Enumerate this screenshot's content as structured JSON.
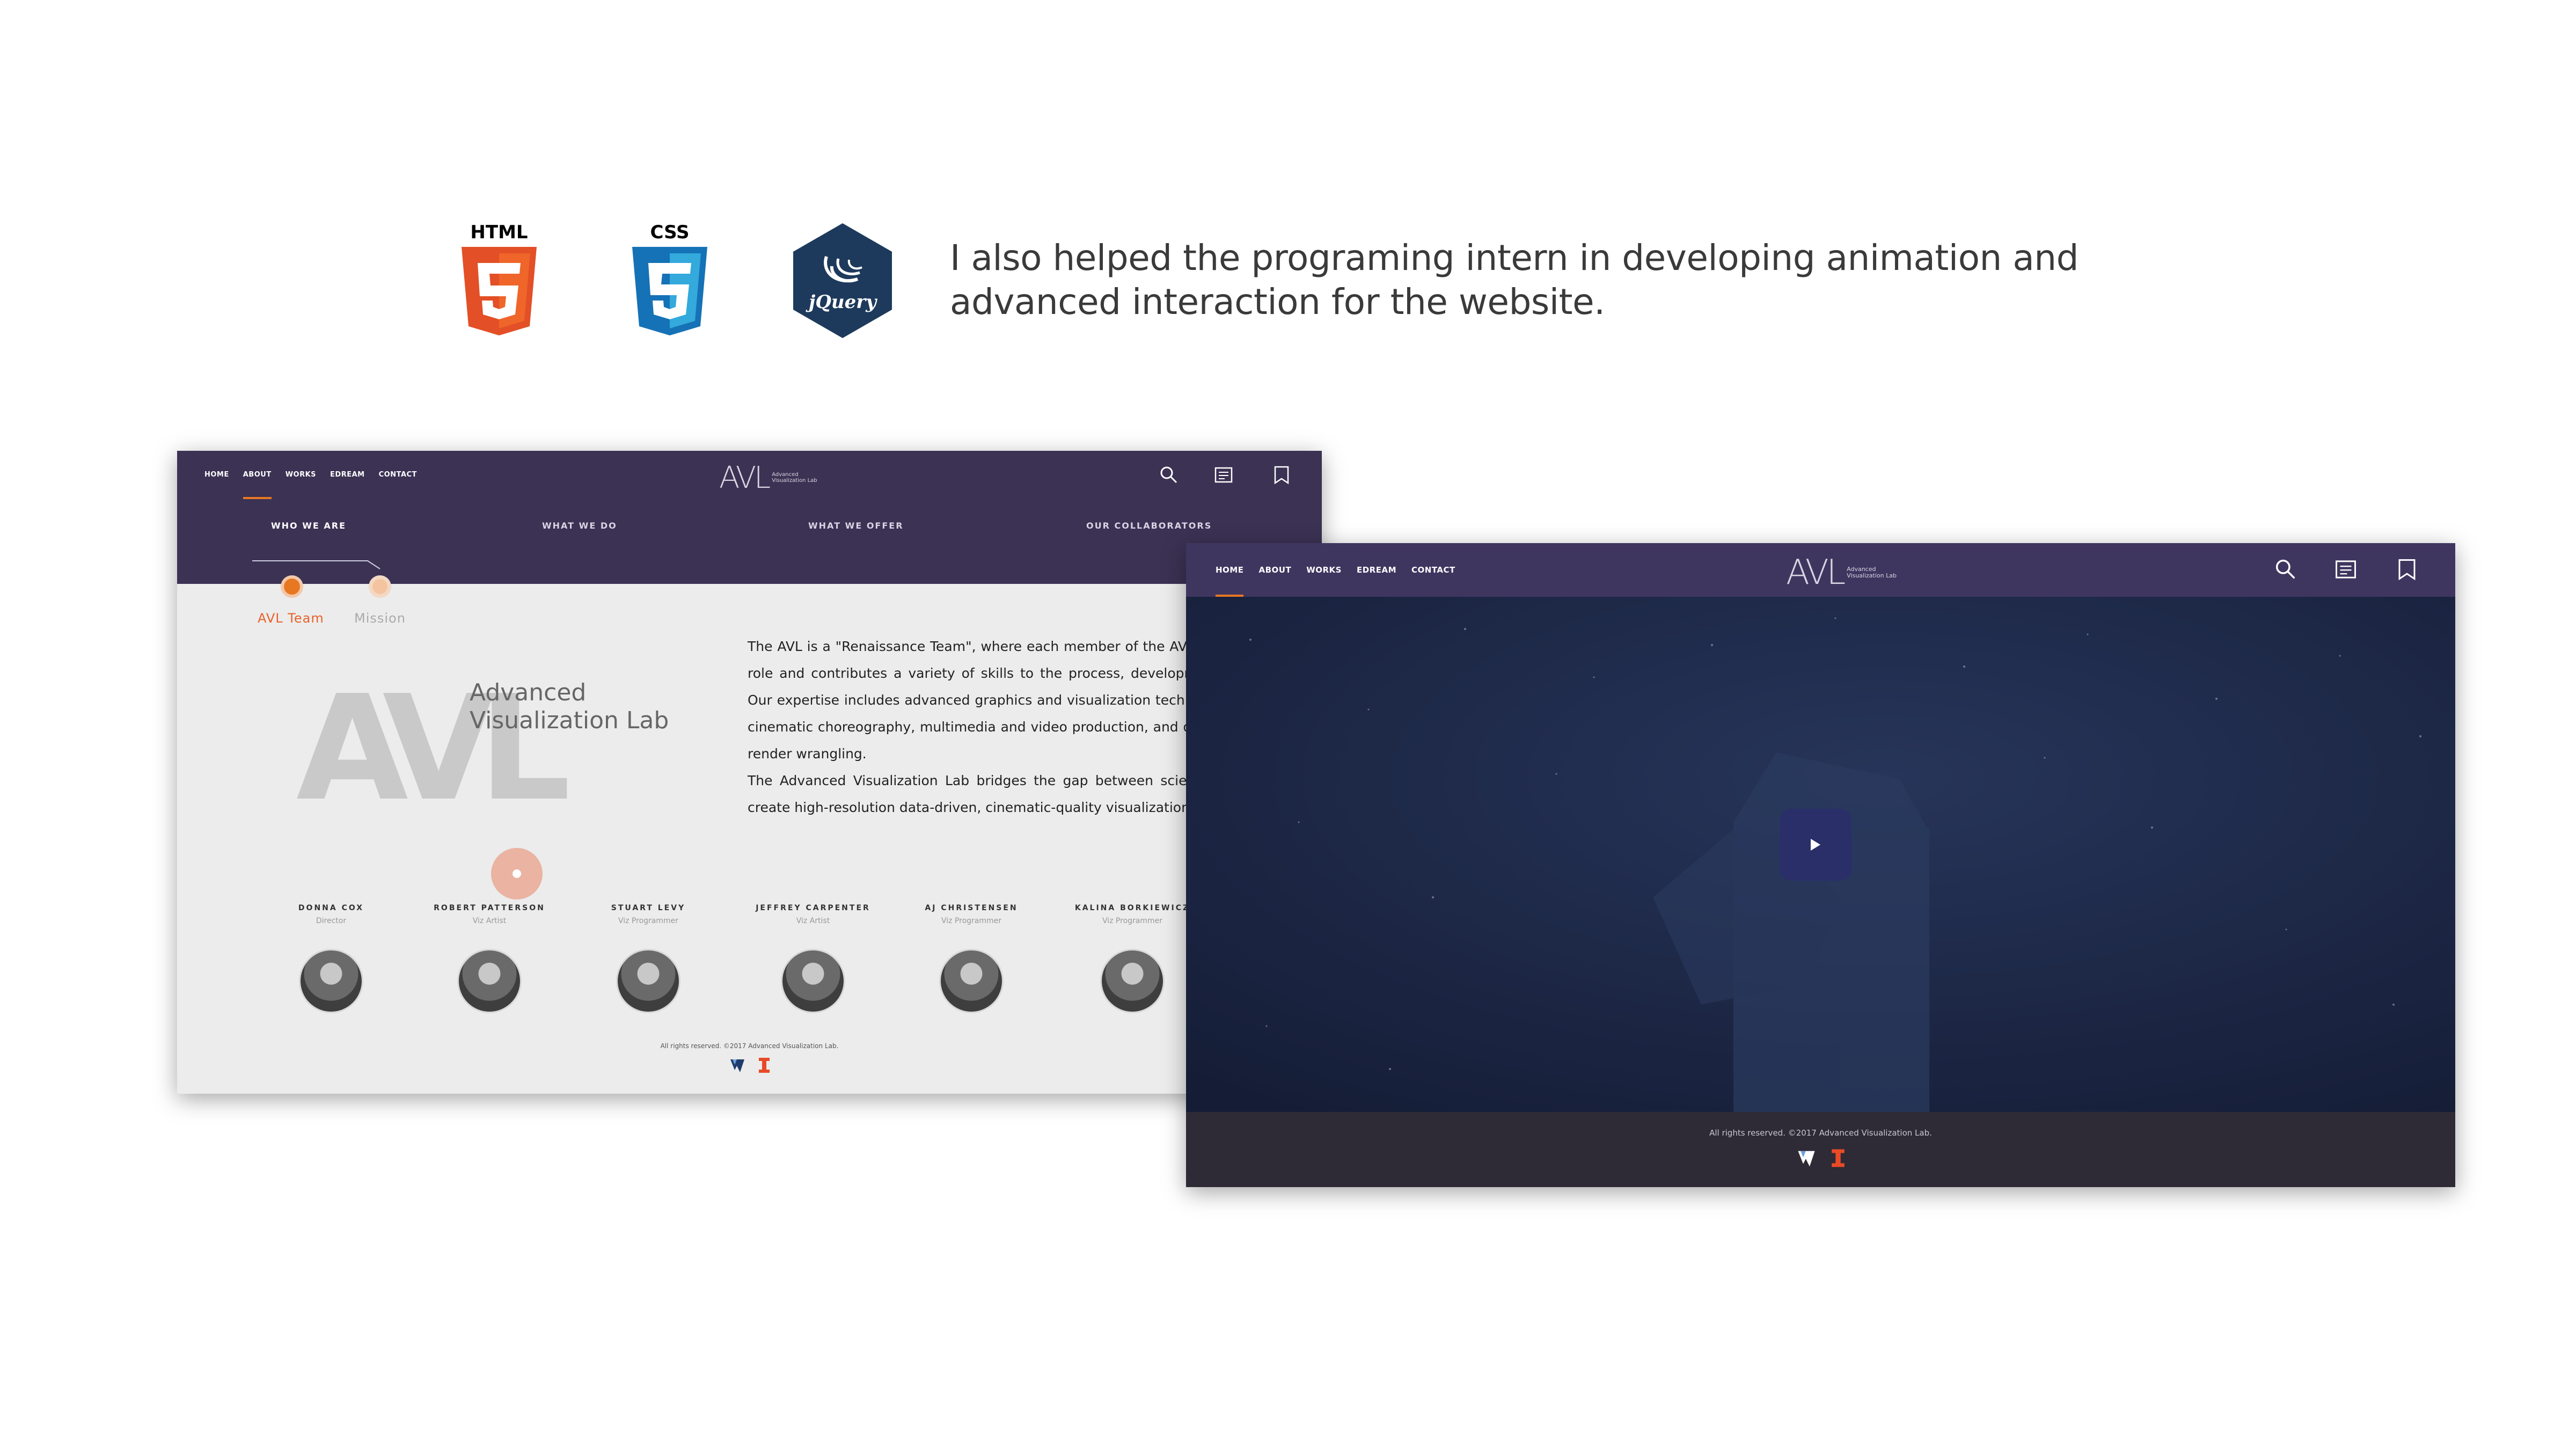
{
  "tech_logos": [
    {
      "label": "HTML",
      "icon": "html5-logo-icon",
      "color": "#e34f26"
    },
    {
      "label": "CSS",
      "icon": "css3-logo-icon",
      "color": "#1572b6"
    },
    {
      "label": "jQuery",
      "icon": "jquery-logo-icon",
      "color": "#1d3a5c"
    }
  ],
  "caption": "I also helped the programing intern in developing animation and advanced interaction for the website.",
  "site_about": {
    "nav": [
      "HOME",
      "ABOUT",
      "WORKS",
      "EDREAM",
      "CONTACT"
    ],
    "active_nav": "ABOUT",
    "brand": {
      "mark": "AVL",
      "sub_line1": "Advanced",
      "sub_line2": "Visualization Lab"
    },
    "subnav": [
      "WHO WE ARE",
      "WHAT WE DO",
      "WHAT WE OFFER",
      "OUR COLLABORATORS"
    ],
    "timeline": {
      "active": "AVL Team",
      "inactive": "Mission"
    },
    "logo_big": {
      "mark": "AVL",
      "line1": "Advanced",
      "line2": "Visualization Lab"
    },
    "about_p1": "The AVL is a \"Renaissance Team\", where each member of the AVL team plays a unique role and contributes a variety of skills to the process, development, and production.  Our expertise includes advanced graphics and visualization techniques, artistic design, cinematic choreography, multimedia and video production, and data management and render wrangling.",
    "about_p2": "The Advanced Visualization Lab bridges the gap between science and the arts. We create high-resolution data-driven, cinematic-quality visualizations for public outreach.",
    "members": [
      {
        "name": "DONNA COX",
        "role": "Director"
      },
      {
        "name": "ROBERT PATTERSON",
        "role": "Viz Artist"
      },
      {
        "name": "STUART LEVY",
        "role": "Viz Programmer"
      },
      {
        "name": "JEFFREY CARPENTER",
        "role": "Viz Artist"
      },
      {
        "name": "AJ CHRISTENSEN",
        "role": "Viz Programmer"
      },
      {
        "name": "KALINA BORKIEWICZ",
        "role": "Viz Programmer"
      }
    ],
    "footer": "All rights reserved. ©2017 Advanced Visualization Lab."
  },
  "site_home": {
    "nav": [
      "HOME",
      "ABOUT",
      "WORKS",
      "EDREAM",
      "CONTACT"
    ],
    "active_nav": "HOME",
    "brand": {
      "mark": "AVL",
      "sub_line1": "Advanced",
      "sub_line2": "Visualization Lab"
    },
    "footer": "All rights reserved. ©2017 Advanced Visualization Lab."
  },
  "colors": {
    "nav_bg": "#3b3254",
    "accent": "#e87722",
    "hero_bg": "#1b2541",
    "footer_bg": "#2e2a36"
  },
  "icons": [
    "search-icon",
    "news-icon",
    "bookmark-icon",
    "play-icon",
    "illinois-logo-icon",
    "university-logo-icon"
  ]
}
